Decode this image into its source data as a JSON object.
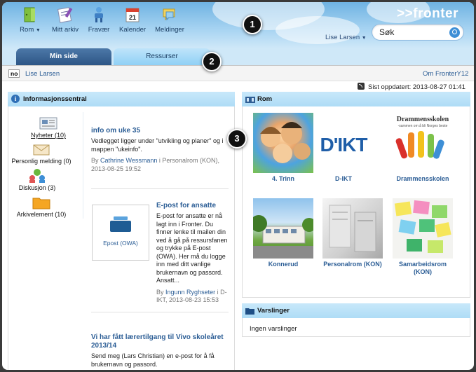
{
  "toolbar": {
    "items": [
      {
        "label": "Rom",
        "icon": "door-icon",
        "dropdown": true
      },
      {
        "label": "Mitt arkiv",
        "icon": "archive-icon"
      },
      {
        "label": "Fravær",
        "icon": "absence-icon"
      },
      {
        "label": "Kalender",
        "icon": "calendar-icon",
        "day": "21"
      },
      {
        "label": "Meldinger",
        "icon": "messages-icon"
      }
    ],
    "logo": ">>fronter",
    "user": "Lise Larsen",
    "search_value": "Søk"
  },
  "tabs": [
    {
      "label": "Min side",
      "active": true
    },
    {
      "label": "Ressurser",
      "active": false
    }
  ],
  "subbar": {
    "lang_badge": "no",
    "user_link": "Lise Larsen",
    "about_link": "Om FronterY12"
  },
  "updated_text": "Sist oppdatert: 2013-08-27 01:41",
  "info_panel": {
    "title": "Informasjonssentral",
    "nav": [
      {
        "label": "Nyheter (10)",
        "icon": "news-icon"
      },
      {
        "label": "Personlig melding (0)",
        "icon": "envelope-icon"
      },
      {
        "label": "Diskusjon (3)",
        "icon": "discussion-icon"
      },
      {
        "label": "Arkivelement (10)",
        "icon": "folder-icon"
      }
    ],
    "news": [
      {
        "title": "info om uke 35",
        "body": "Vedlegget ligger under \"utvikling og planer\" og i mappen \"ukeinfo\".",
        "by_prefix": "By",
        "author": "Cathrine Wessmann",
        "meta": "i Personalrom (KON), 2013-08-25 19:52"
      },
      {
        "title": "E-post for ansatte",
        "body": "E-post for ansatte er nå lagt inn i Fronter. Du finner lenke til mailen din ved å gå på ressursfanen og trykke på E-post (OWA). Her må du logge inn med ditt vanlige brukernavn og passord. Ansatt...",
        "by_prefix": "By",
        "author": "Ingunn Ryghseter",
        "meta": "i D-IKT, 2013-08-23 15:53",
        "attachment": "Epost (OWA)"
      },
      {
        "title": "Vi har fått lærertilgang til Vivo skoleåret 2013/14",
        "body": "Send meg (Lars Christian) en e-post for å få brukernavn og passord."
      }
    ]
  },
  "rooms_panel": {
    "title": "Rom",
    "rooms": [
      {
        "label": "4. Trinn"
      },
      {
        "label": "D-IKT",
        "logo_text": "D'IKT"
      },
      {
        "label": "Drammensskolen",
        "logo_text": "Drammensskolen",
        "logo_sub": "-sammen om å bli Norges beste"
      },
      {
        "label": "Konnerud"
      },
      {
        "label": "Personalrom (KON)"
      },
      {
        "label": "Samarbeidsrom (KON)"
      }
    ]
  },
  "alerts_panel": {
    "title": "Varslinger",
    "empty_text": "Ingen varslinger"
  },
  "callouts": [
    "1",
    "2",
    "3"
  ]
}
